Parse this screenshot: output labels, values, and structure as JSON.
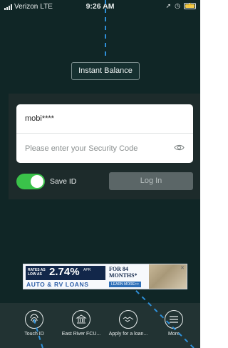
{
  "status_bar": {
    "carrier": "Verizon",
    "network": "LTE",
    "time": "9:26 AM"
  },
  "top": {
    "instant_balance_label": "Instant Balance"
  },
  "login": {
    "username_value": "mobi****",
    "security_code_placeholder": "Please enter your Security Code",
    "save_id_label": "Save ID",
    "save_id_on": true,
    "login_button_label": "Log In"
  },
  "ad": {
    "rates_text": "RATES AS LOW AS",
    "rate": "2.74%",
    "apr_text": "APR",
    "months_text": "FOR 84 MONTHS*",
    "product_text": "AUTO & RV LOANS",
    "learn_more_text": "LEARN MORE>>"
  },
  "nav": {
    "items": [
      {
        "label": "Touch ID",
        "icon": "fingerprint-icon"
      },
      {
        "label": "East River FCU...",
        "icon": "bank-icon"
      },
      {
        "label": "Apply for a loan...",
        "icon": "handshake-icon"
      },
      {
        "label": "More",
        "icon": "menu-icon"
      }
    ]
  },
  "colors": {
    "background": "#102626",
    "toggle_on": "#3ac24a",
    "login_button": "#5b6667",
    "overlay_line": "#2e8fd8"
  }
}
